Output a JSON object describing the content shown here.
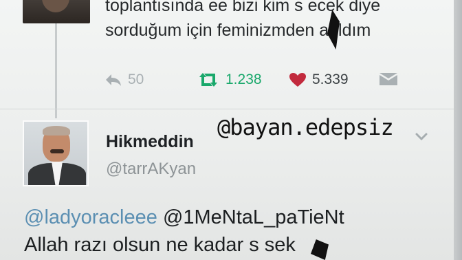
{
  "parent_tweet": {
    "lines": [
      "",
      "toplantısında ee bizi kim s   ecek diye",
      "sorduğum için feminizmden atıldım"
    ],
    "actions": {
      "reply_count": "50",
      "retweet_count": "1.238",
      "like_count": "5.339"
    }
  },
  "reply_tweet": {
    "display_name": "Hikmeddin",
    "handle": "@tarrAKyan",
    "mentions": [
      "@ladyoracleee",
      "@1MeNtaL_paTieNt"
    ],
    "text": "Allah razı olsun ne kadar s    sek"
  },
  "overlay": {
    "watermark": "@bayan.edepsiz"
  },
  "colors": {
    "retweet_green": "#19a86b",
    "like_red": "#c22a3d",
    "mention_blue": "#5b8fb2"
  },
  "icons": [
    "reply-icon",
    "retweet-icon",
    "heart-icon",
    "message-icon",
    "chevron-down-icon"
  ]
}
